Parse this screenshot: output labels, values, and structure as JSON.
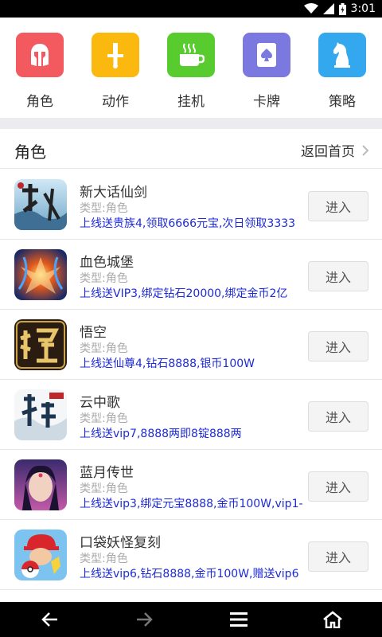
{
  "status_bar": {
    "time": "3:01"
  },
  "categories": [
    {
      "label": "角色",
      "color": "#f25a5f",
      "icon": "helmet-icon"
    },
    {
      "label": "动作",
      "color": "#fbb80f",
      "icon": "sword-icon"
    },
    {
      "label": "挂机",
      "color": "#58cc2e",
      "icon": "coffee-cup-icon"
    },
    {
      "label": "卡牌",
      "color": "#7b79e0",
      "icon": "spade-card-icon"
    },
    {
      "label": "策略",
      "color": "#34a8ef",
      "icon": "chess-knight-icon"
    }
  ],
  "section": {
    "title": "角色",
    "back_label": "返回首页"
  },
  "games": [
    {
      "name": "新大话仙剑",
      "type": "类型:角色",
      "promo": "上线送贵族4,领取6666元宝,次日领取3333",
      "button": "进入"
    },
    {
      "name": "血色城堡",
      "type": "类型:角色",
      "promo": "上线送VIP3,绑定钻石20000,绑定金币2亿",
      "button": "进入"
    },
    {
      "name": "悟空",
      "type": "类型:角色",
      "promo": "上线送仙尊4,钻石8888,银币100W",
      "button": "进入"
    },
    {
      "name": "云中歌",
      "type": "类型:角色",
      "promo": "上线送vip7,8888两即8锭888两",
      "button": "进入"
    },
    {
      "name": "蓝月传世",
      "type": "类型:角色",
      "promo": "上线送vip3,绑定元宝8888,金币100W,vip1-",
      "button": "进入"
    },
    {
      "name": "口袋妖怪复刻",
      "type": "类型:角色",
      "promo": "上线送vip6,钻石8888,金币100W,赠送vip6",
      "button": "进入"
    }
  ],
  "colors": {
    "accent_promo": "#1d2bd6",
    "background_band": "#ececf0"
  }
}
